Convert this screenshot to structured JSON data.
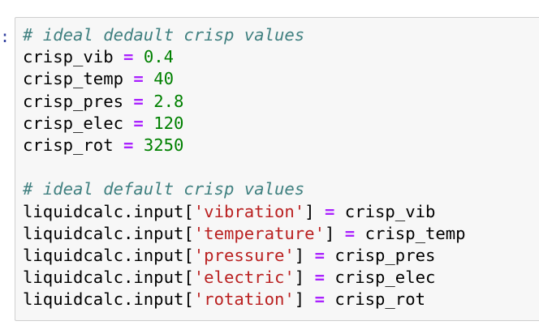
{
  "cell": {
    "prompt": ":",
    "lines": [
      {
        "type": "comment",
        "text": "# ideal dedault crisp values"
      },
      {
        "type": "assign",
        "var": "crisp_vib",
        "op": "=",
        "value": "0.4"
      },
      {
        "type": "assign",
        "var": "crisp_temp",
        "op": "=",
        "value": "40"
      },
      {
        "type": "assign",
        "var": "crisp_pres",
        "op": "=",
        "value": "2.8"
      },
      {
        "type": "assign",
        "var": "crisp_elec",
        "op": "=",
        "value": "120"
      },
      {
        "type": "assign",
        "var": "crisp_rot",
        "op": "=",
        "value": "3250"
      },
      {
        "type": "blank"
      },
      {
        "type": "comment",
        "text": "# ideal default crisp values"
      },
      {
        "type": "input",
        "obj": "liquidcalc.input[",
        "key": "'vibration'",
        "close": "]",
        "op": "=",
        "value": "crisp_vib"
      },
      {
        "type": "input",
        "obj": "liquidcalc.input[",
        "key": "'temperature'",
        "close": "]",
        "op": "=",
        "value": "crisp_temp"
      },
      {
        "type": "input",
        "obj": "liquidcalc.input[",
        "key": "'pressure'",
        "close": "]",
        "op": "=",
        "value": "crisp_pres"
      },
      {
        "type": "input",
        "obj": "liquidcalc.input[",
        "key": "'electric'",
        "close": "]",
        "op": "=",
        "value": "crisp_elec"
      },
      {
        "type": "input",
        "obj": "liquidcalc.input[",
        "key": "'rotation'",
        "close": "]",
        "op": "=",
        "value": "crisp_rot"
      }
    ]
  },
  "colors": {
    "comment": "#408080",
    "operator": "#aa22ff",
    "number": "#008000",
    "string": "#ba2121",
    "prompt": "#303f9f",
    "cell_background": "#f7f7f7",
    "cell_border": "#cfcfcf"
  }
}
